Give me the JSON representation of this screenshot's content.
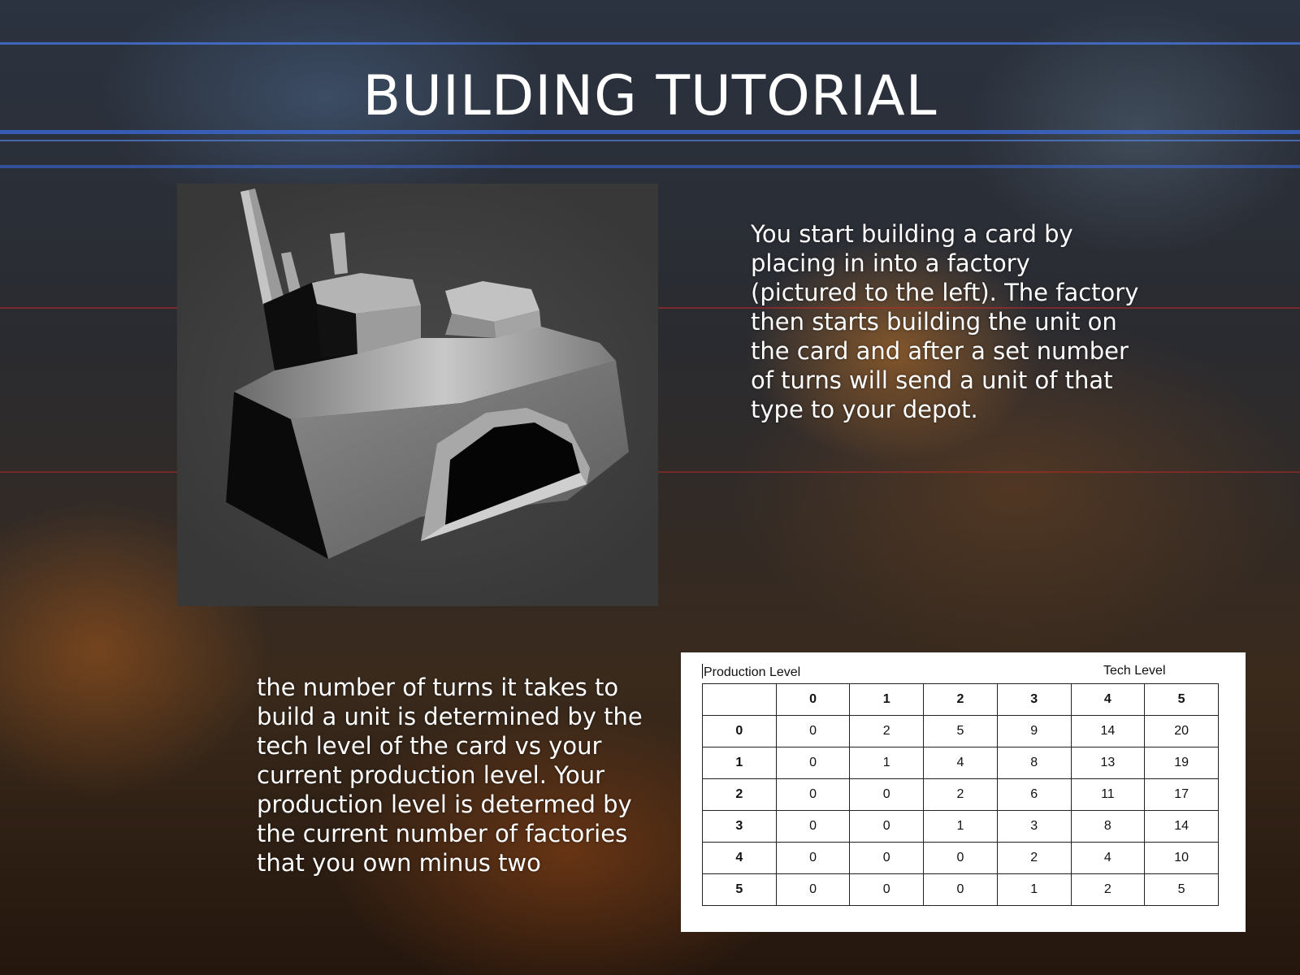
{
  "slide": {
    "title": "BUILDING TUTORIAL",
    "factory_image_alt": "factory",
    "intro_text": "You start building a card by placing in into a factory (pictured to the left). The factory then starts building the unit on the card and after a set number of turns will send a unit of that type to your depot.",
    "detail_text": "the number of turns it takes to build a unit is determined by the tech level of the card vs your current production level. Your production level is determed by the current number of factories that you own minus two"
  },
  "table": {
    "row_axis_label": "Production Level",
    "column_axis_label": "Tech Level",
    "corner": "",
    "column_headers": [
      "0",
      "1",
      "2",
      "3",
      "4",
      "5"
    ],
    "rows": [
      {
        "header": "0",
        "cells": [
          "0",
          "2",
          "5",
          "9",
          "14",
          "20"
        ]
      },
      {
        "header": "1",
        "cells": [
          "0",
          "1",
          "4",
          "8",
          "13",
          "19"
        ]
      },
      {
        "header": "2",
        "cells": [
          "0",
          "0",
          "2",
          "6",
          "11",
          "17"
        ]
      },
      {
        "header": "3",
        "cells": [
          "0",
          "0",
          "1",
          "3",
          "8",
          "14"
        ]
      },
      {
        "header": "4",
        "cells": [
          "0",
          "0",
          "0",
          "2",
          "4",
          "10"
        ]
      },
      {
        "header": "5",
        "cells": [
          "0",
          "0",
          "0",
          "1",
          "2",
          "5"
        ]
      }
    ]
  },
  "colors": {
    "text": "#ffffff",
    "accent_stripe": "#4678e6",
    "table_background": "#ffffff",
    "factory_panel": "#404040"
  }
}
